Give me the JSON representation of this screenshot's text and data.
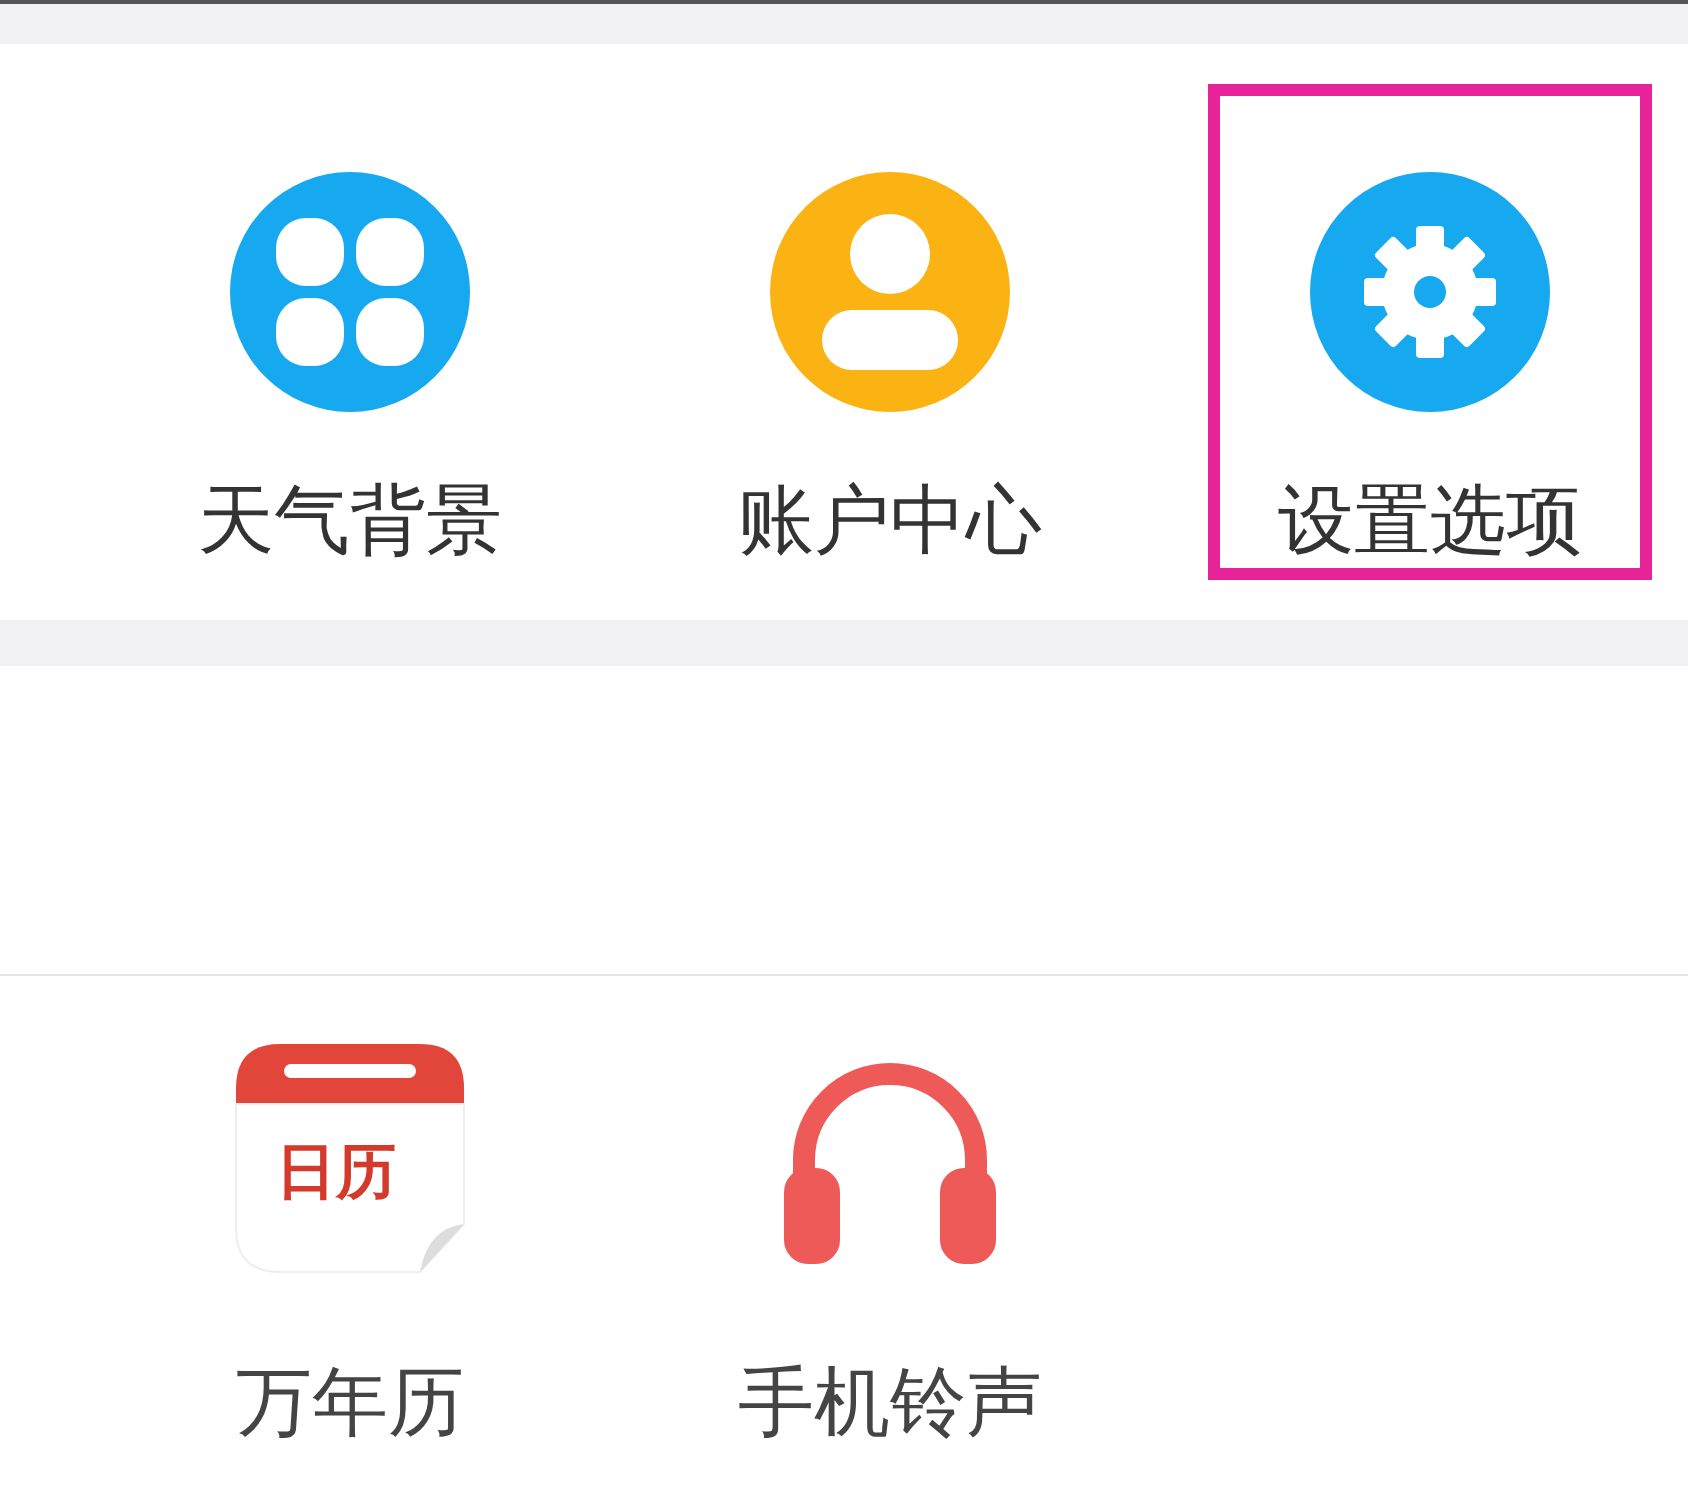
{
  "top_menu": {
    "items": [
      {
        "kind": "clover",
        "label": "天气背景",
        "highlighted": false
      },
      {
        "kind": "person",
        "label": "账户中心",
        "highlighted": false
      },
      {
        "kind": "gear",
        "label": "设置选项",
        "highlighted": true
      }
    ]
  },
  "tools": {
    "items": [
      {
        "kind": "calendar",
        "label": "万年历",
        "icon_text": "日历"
      },
      {
        "kind": "headphones",
        "label": "手机铃声"
      }
    ]
  }
}
